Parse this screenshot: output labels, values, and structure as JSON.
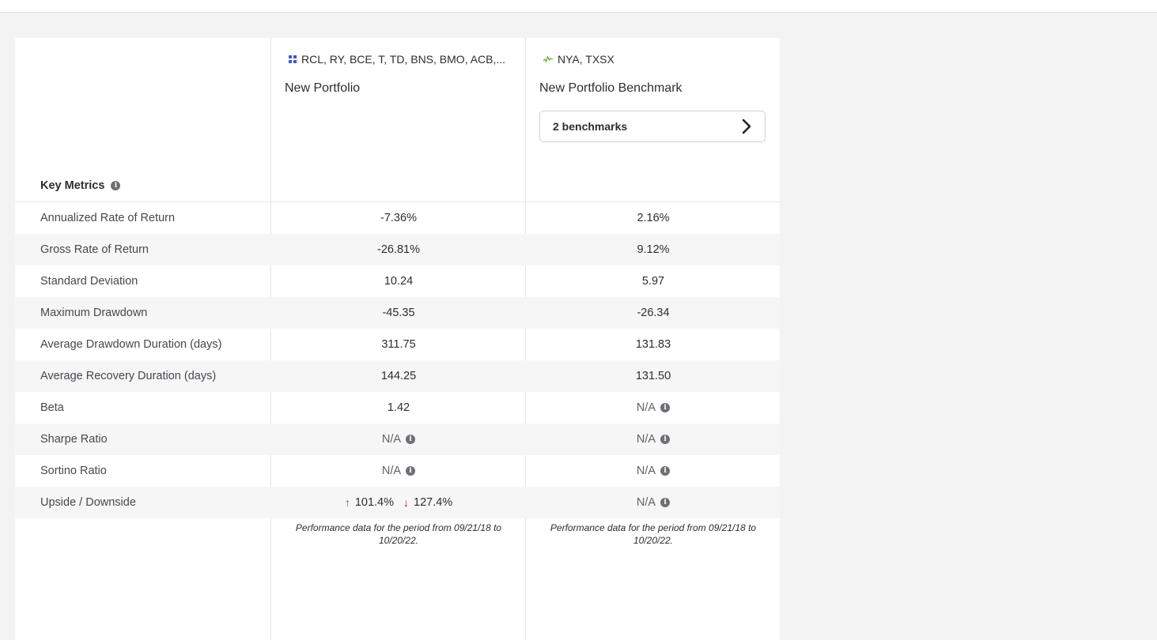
{
  "key_metrics_label": "Key Metrics",
  "columns": [
    {
      "tickers": "RCL, RY, BCE, T, TD, BNS, BMO, ACB,...",
      "name": "New Portfolio",
      "icon": "portfolio-grid-icon",
      "note": "Performance data for the period from 09/21/18 to 10/20/22."
    },
    {
      "tickers": "NYA, TXSX",
      "name": "New Portfolio Benchmark",
      "icon": "benchmark-line-icon",
      "benchmark_button": "2 benchmarks",
      "note": "Performance data for the period from 09/21/18 to 10/20/22."
    }
  ],
  "metrics": [
    {
      "label": "Annualized Rate of Return",
      "portfolio": "-7.36%",
      "benchmark": "2.16%"
    },
    {
      "label": "Gross Rate of Return",
      "portfolio": "-26.81%",
      "benchmark": "9.12%"
    },
    {
      "label": "Standard Deviation",
      "portfolio": "10.24",
      "benchmark": "5.97"
    },
    {
      "label": "Maximum Drawdown",
      "portfolio": "-45.35",
      "benchmark": "-26.34"
    },
    {
      "label": "Average Drawdown Duration (days)",
      "portfolio": "311.75",
      "benchmark": "131.83"
    },
    {
      "label": "Average Recovery Duration (days)",
      "portfolio": "144.25",
      "benchmark": "131.50"
    },
    {
      "label": "Beta",
      "portfolio": "1.42",
      "benchmark": "N/A"
    },
    {
      "label": "Sharpe Ratio",
      "portfolio": "N/A",
      "benchmark": "N/A"
    },
    {
      "label": "Sortino Ratio",
      "portfolio": "N/A",
      "benchmark": "N/A"
    },
    {
      "label": "Upside / Downside",
      "portfolio_up": "101.4%",
      "portfolio_down": "127.4%",
      "benchmark": "N/A"
    }
  ],
  "colors": {
    "up": "#2f7d32",
    "down": "#b3261e",
    "grid_icon": "#3d5bc7",
    "benchmark_icon": "#6fae3a"
  }
}
